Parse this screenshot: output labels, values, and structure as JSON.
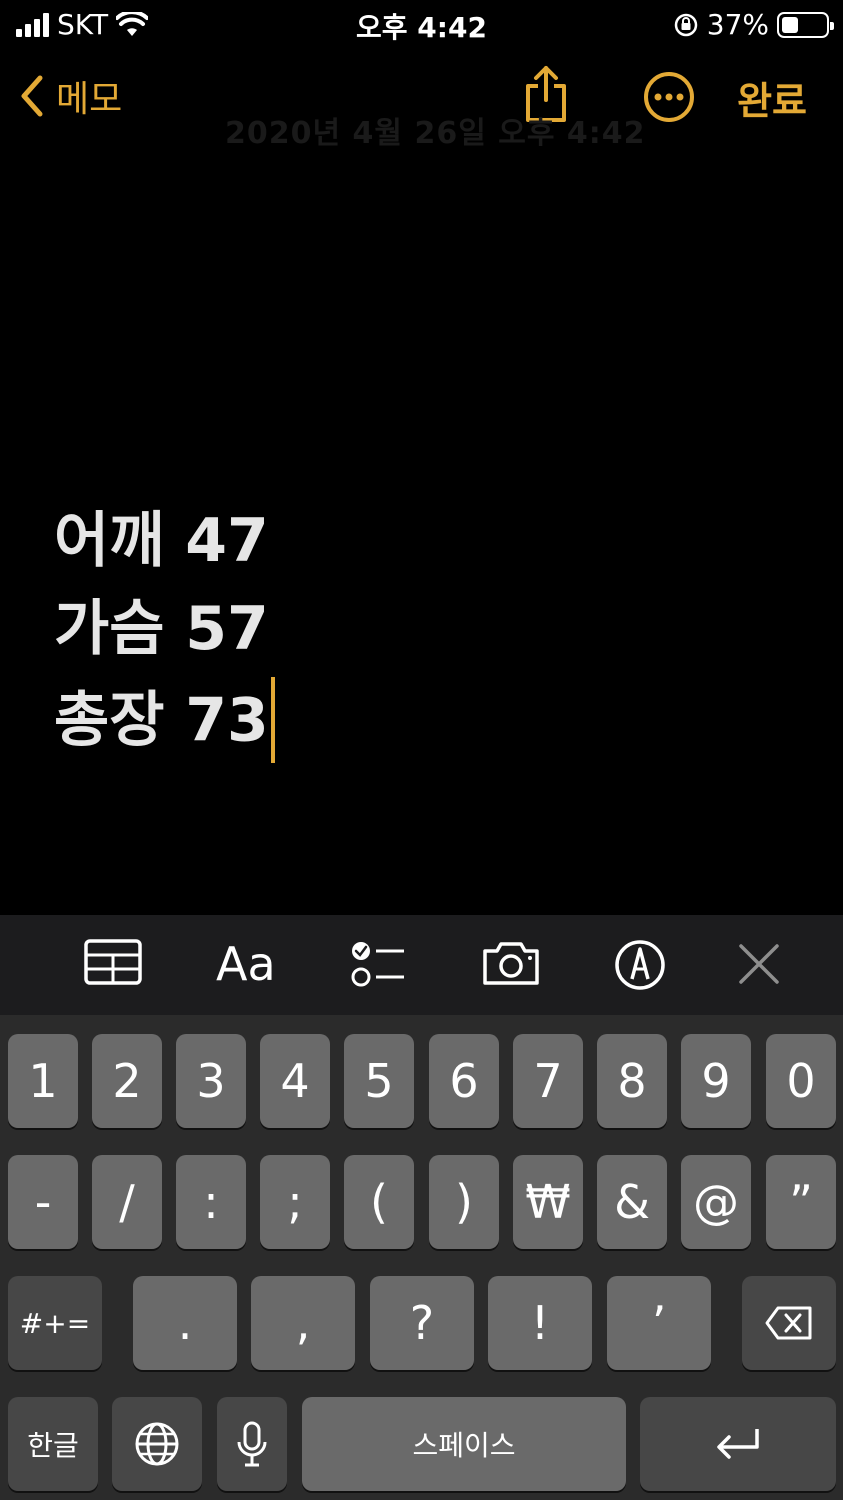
{
  "status_bar": {
    "carrier": "SKT",
    "time": "오후 4:42",
    "battery_percent": "37%",
    "battery_level": 0.37
  },
  "nav": {
    "back_label": "메모",
    "done_label": "완료",
    "faded_date": "2020년 4월 26일 오후 4:42"
  },
  "note": {
    "lines": [
      "어깨 47",
      "가슴 57",
      "총장 73"
    ]
  },
  "toolbar": {
    "format_label": "Aa"
  },
  "keyboard": {
    "row1": [
      "1",
      "2",
      "3",
      "4",
      "5",
      "6",
      "7",
      "8",
      "9",
      "0"
    ],
    "row2": [
      "-",
      "/",
      ":",
      ";",
      "(",
      ")",
      "₩",
      "&",
      "@",
      "”"
    ],
    "row3": {
      "shift_label": "#+=",
      "keys": [
        ".",
        ",",
        "?",
        "!",
        "’"
      ]
    },
    "row4": {
      "lang_label": "한글",
      "space_label": "스페이스"
    }
  },
  "colors": {
    "accent": "#e3a935",
    "key": "#6a6a6a",
    "key_dark": "#474747",
    "keyboard_bg": "#2b2b2b",
    "toolbar_bg": "#1c1c1e"
  }
}
